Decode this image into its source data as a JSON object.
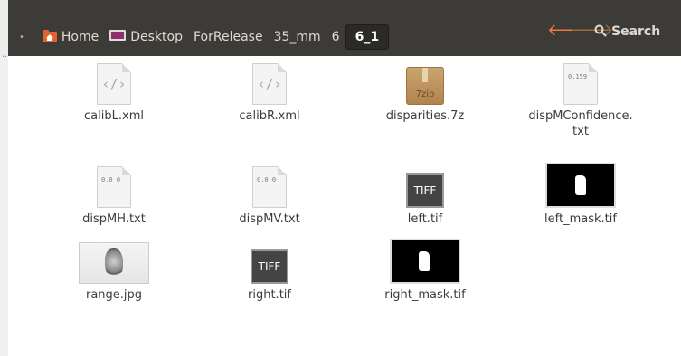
{
  "path": {
    "crumbs": [
      {
        "label": "Home",
        "icon": "home-folder-icon"
      },
      {
        "label": "Desktop",
        "icon": "desktop-icon"
      },
      {
        "label": "ForRelease"
      },
      {
        "label": "35_mm"
      },
      {
        "label": "6"
      },
      {
        "label": "6_1",
        "active": true
      }
    ]
  },
  "toolbar": {
    "search_label": "Search"
  },
  "files": [
    {
      "name": "calibL.xml",
      "icon": "xml-file-icon"
    },
    {
      "name": "calibR.xml",
      "icon": "xml-file-icon"
    },
    {
      "name": "disparities.7z",
      "icon": "archive-7z-icon",
      "icon_text": "7zip"
    },
    {
      "name": "dispMConfidence.",
      "name2": "txt",
      "icon": "text-file-icon",
      "icon_text": "0.159"
    },
    {
      "name": "dispMH.txt",
      "icon": "text-file-icon",
      "icon_text": "0.0 0"
    },
    {
      "name": "dispMV.txt",
      "icon": "text-file-icon",
      "icon_text": "0.0 0"
    },
    {
      "name": "left.tif",
      "icon": "tiff-file-icon",
      "icon_text": "TIFF"
    },
    {
      "name": "left_mask.tif",
      "icon": "image-thumbnail"
    },
    {
      "name": "range.jpg",
      "icon": "image-thumbnail"
    },
    {
      "name": "right.tif",
      "icon": "tiff-file-icon",
      "icon_text": "TIFF"
    },
    {
      "name": "right_mask.tif",
      "icon": "image-thumbnail"
    }
  ],
  "colors": {
    "toolbar_bg": "#3c3b37",
    "back_arrow": "#ef7b3f",
    "forward_arrow": "#9c6a3e"
  }
}
